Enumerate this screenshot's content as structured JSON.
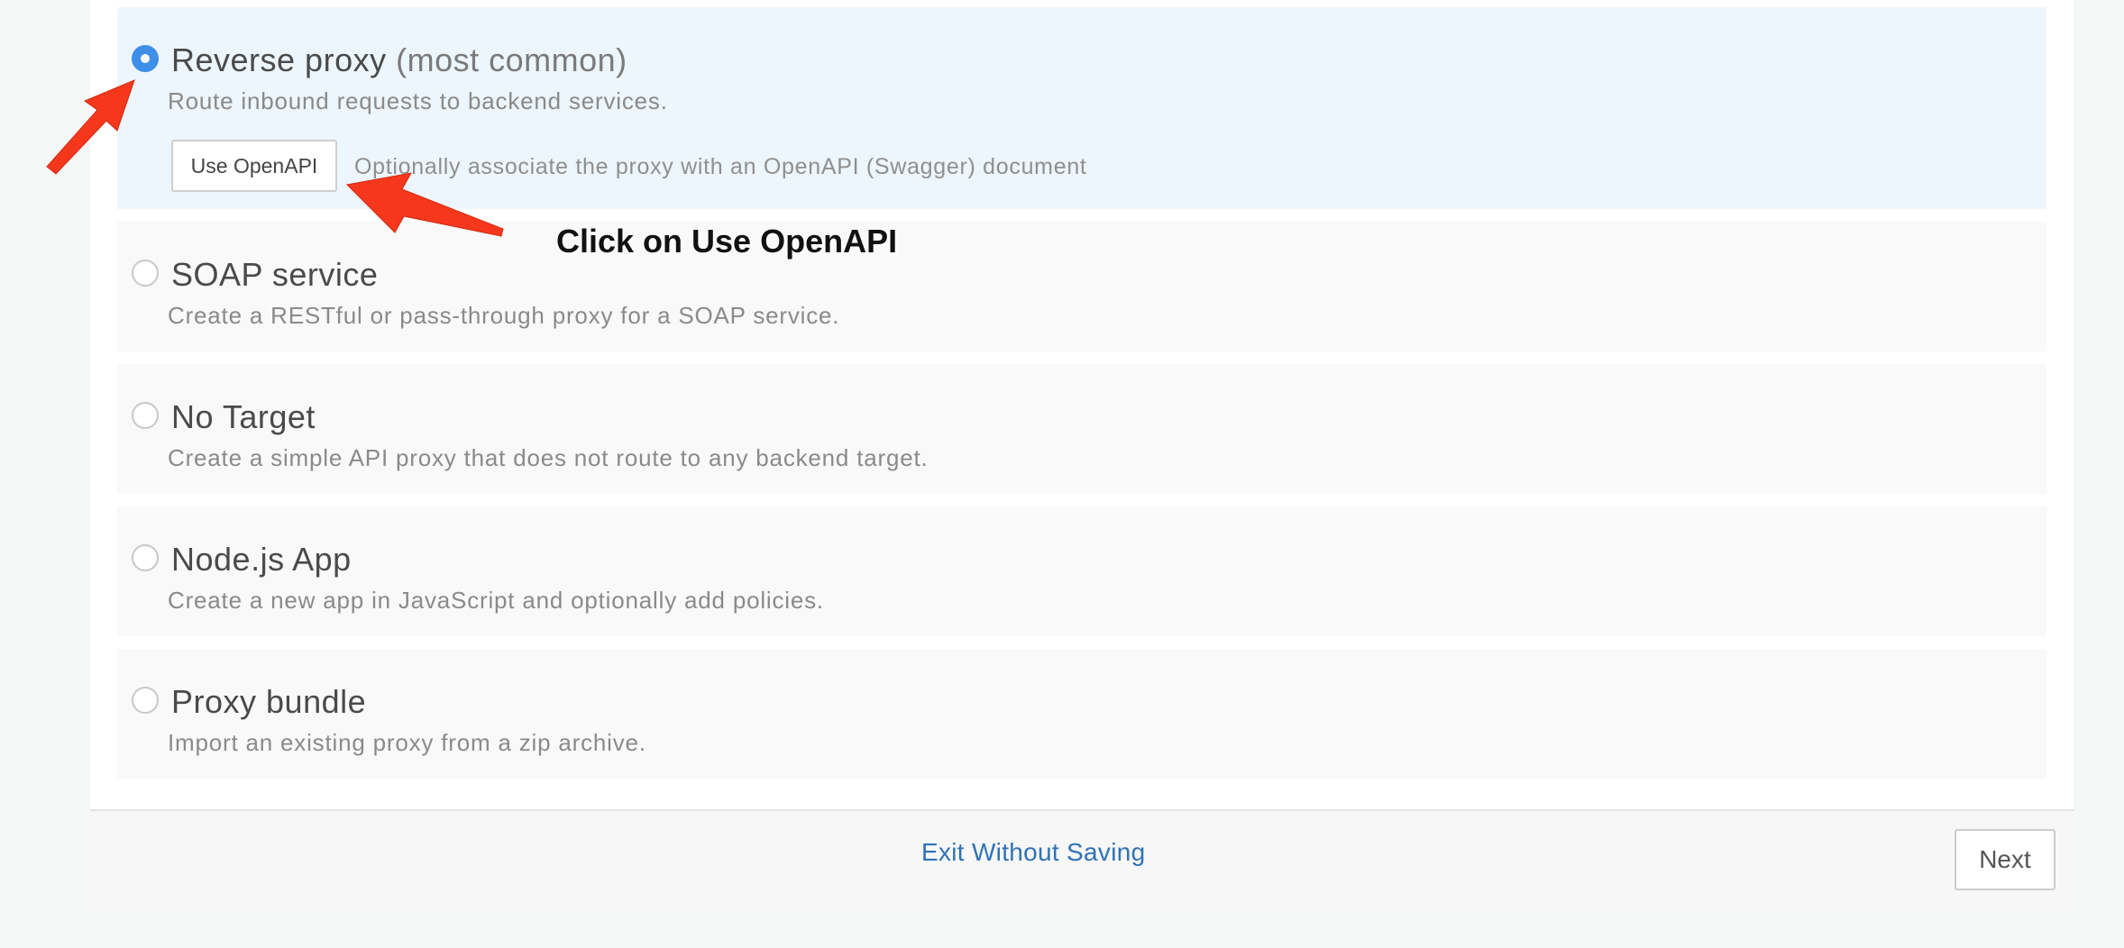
{
  "options": [
    {
      "title": "Reverse proxy",
      "title_suffix": "(most common)",
      "description": "Route inbound requests to backend services.",
      "selected": true,
      "openapi_button": "Use OpenAPI",
      "openapi_hint": "Optionally associate the proxy with an OpenAPI (Swagger) document"
    },
    {
      "title": "SOAP service",
      "description": "Create a RESTful or pass-through proxy for a SOAP service.",
      "selected": false
    },
    {
      "title": "No Target",
      "description": "Create a simple API proxy that does not route to any backend target.",
      "selected": false
    },
    {
      "title": "Node.js App",
      "description": "Create a new app in JavaScript and optionally add policies.",
      "selected": false
    },
    {
      "title": "Proxy bundle",
      "description": "Import an existing proxy from a zip archive.",
      "selected": false
    }
  ],
  "annotation": {
    "text": "Click on Use OpenAPI",
    "arrow_color": "#f5381c"
  },
  "footer": {
    "exit_label": "Exit Without Saving",
    "next_label": "Next"
  },
  "colors": {
    "accent": "#3d8fe8",
    "link": "#2f72b5",
    "selected_bg": "#edf5fd"
  }
}
